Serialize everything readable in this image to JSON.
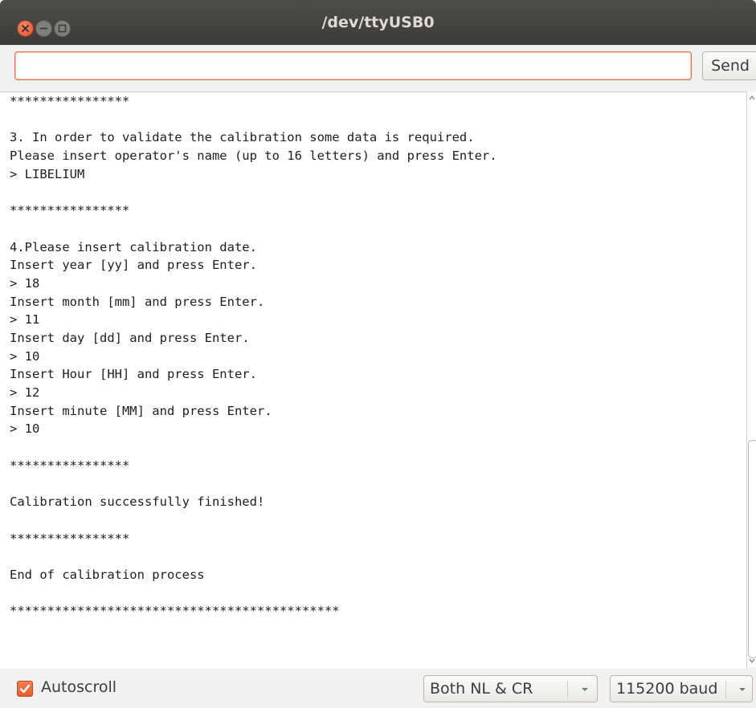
{
  "window": {
    "title": "/dev/ttyUSB0"
  },
  "input": {
    "value": "",
    "send_label": "Send"
  },
  "console": {
    "lines": [
      "****************",
      "",
      "3. In order to validate the calibration some data is required.",
      "Please insert operator's name (up to 16 letters) and press Enter.",
      "> LIBELIUM",
      "",
      "****************",
      "",
      "4.Please insert calibration date.",
      "Insert year [yy] and press Enter.",
      "> 18",
      "Insert month [mm] and press Enter.",
      "> 11",
      "Insert day [dd] and press Enter.",
      "> 10",
      "Insert Hour [HH] and press Enter.",
      "> 12",
      "Insert minute [MM] and press Enter.",
      "> 10",
      "",
      "****************",
      "",
      "Calibration successfully finished!",
      "",
      "****************",
      "",
      "End of calibration process",
      "",
      "********************************************"
    ]
  },
  "status": {
    "autoscroll_label": "Autoscroll",
    "autoscroll_checked": true,
    "line_ending": "Both NL & CR",
    "baud": "115200 baud"
  },
  "colors": {
    "accent": "#e0622c",
    "titlebar": "#3c3b37"
  }
}
